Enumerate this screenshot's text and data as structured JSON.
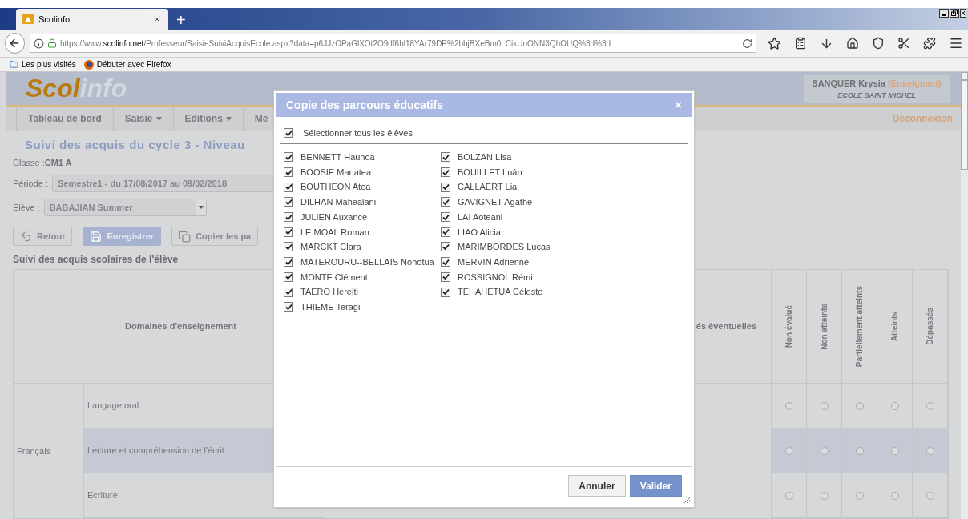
{
  "browser": {
    "tab_title": "Scolinfo",
    "new_tab": "+",
    "url_prefix": "https://www.",
    "url_domain": "scolinfo.net",
    "url_path": "/Professeur/SaisieSuiviAcquisEcole.aspx?data=p6JJzOPaGlXOt2O9df6hl18YAr79DP%2bbjBXeBm0LCikUoONN3QhOUQ%3d%3d",
    "bookmarks": [
      {
        "label": "Les plus visités",
        "kind": "folder"
      },
      {
        "label": "Débuter avec Firefox",
        "kind": "firefox"
      }
    ]
  },
  "header": {
    "logo_a": "Scol",
    "logo_b": "info",
    "user_name": "SANQUER Krysia",
    "user_role": "(Enseignant)",
    "school": "ECOLE SAINT MICHEL"
  },
  "nav": {
    "items": [
      {
        "label": "Tableau de bord",
        "has_menu": false
      },
      {
        "label": "Saisie",
        "has_menu": true
      },
      {
        "label": "Editions",
        "has_menu": true
      },
      {
        "label": "Me",
        "has_menu": false
      }
    ],
    "logout": "Déconnexion"
  },
  "page_title": "Suivi des acquis du cycle 3 - Niveau",
  "form": {
    "class_label": "Classe : ",
    "class_value": "CM1 A",
    "period_label": "Période :",
    "period_value": "Semestre1 - du 17/08/2017 au 09/02/2018",
    "student_label": "Elève :",
    "student_value": "BABAJIAN Summer"
  },
  "actions": [
    {
      "label": "Retour",
      "kind": "back"
    },
    {
      "label": "Enregistrer",
      "kind": "save"
    },
    {
      "label": "Copier les pa",
      "kind": "copy"
    }
  ],
  "section_title": "Suivi des acquis scolaires de l'élève",
  "table": {
    "domain_header": "Domaines d'enseignement",
    "remarks_header": "és éventuelles",
    "levels": [
      "Non évalué",
      "Non atteints",
      "Partiellement atteints",
      "Atteints",
      "Dépassés"
    ],
    "groups": [
      {
        "name": "Français",
        "rows": [
          {
            "subject": "Langage oral",
            "highlighted": false,
            "choices": [
              {
                "selected": false
              },
              {
                "selected": false
              },
              {
                "selected": false
              },
              {
                "selected": false
              },
              {
                "selected": false
              }
            ]
          },
          {
            "subject": "Lecture et compréhension de l'écrit",
            "highlighted": true,
            "choices": [
              {
                "selected": false
              },
              {
                "selected": false
              },
              {
                "selected": false
              },
              {
                "selected": false
              },
              {
                "selected": false
              }
            ]
          },
          {
            "subject": "Ecriture",
            "highlighted": false,
            "choices": [
              {
                "selected": false
              },
              {
                "selected": false
              },
              {
                "selected": false
              },
              {
                "selected": false
              },
              {
                "selected": false
              }
            ]
          }
        ]
      }
    ]
  },
  "dialog": {
    "title": "Copie des parcours éducatifs",
    "close": "×",
    "select_all": {
      "label": "Sélectionner tous les élèves",
      "checked": true
    },
    "students": [
      {
        "name": "BENNETT Haunoa",
        "checked": true
      },
      {
        "name": "BOLZAN Lisa",
        "checked": true
      },
      {
        "name": "BOOSIE Manatea",
        "checked": true
      },
      {
        "name": "BOUILLET Luân",
        "checked": true
      },
      {
        "name": "BOUTHEON Atea",
        "checked": true
      },
      {
        "name": "CALLAERT Lia",
        "checked": true
      },
      {
        "name": "DILHAN Mahealani",
        "checked": true
      },
      {
        "name": "GAVIGNET Agathe",
        "checked": true
      },
      {
        "name": "JULIEN Auxance",
        "checked": true
      },
      {
        "name": "LAI Aoteani",
        "checked": true
      },
      {
        "name": "LE MOAL Roman",
        "checked": true
      },
      {
        "name": "LIAO Alicia",
        "checked": true
      },
      {
        "name": "MARCKT Clara",
        "checked": true
      },
      {
        "name": "MARIMBORDES Lucas",
        "checked": true
      },
      {
        "name": "MATEROURU--BELLAIS Nohotua",
        "checked": true
      },
      {
        "name": "MERVIN Adrienne",
        "checked": true
      },
      {
        "name": "MONTE Clément",
        "checked": true
      },
      {
        "name": "ROSSIGNOL Rémi",
        "checked": true
      },
      {
        "name": "TAERO Hereiti",
        "checked": true
      },
      {
        "name": "TEHAHETUA Céleste",
        "checked": true
      },
      {
        "name": "THIEME Teragi",
        "checked": true
      }
    ],
    "buttons": [
      {
        "label": "Annuler",
        "kind": "secondary"
      },
      {
        "label": "Valider",
        "kind": "primary"
      }
    ]
  }
}
